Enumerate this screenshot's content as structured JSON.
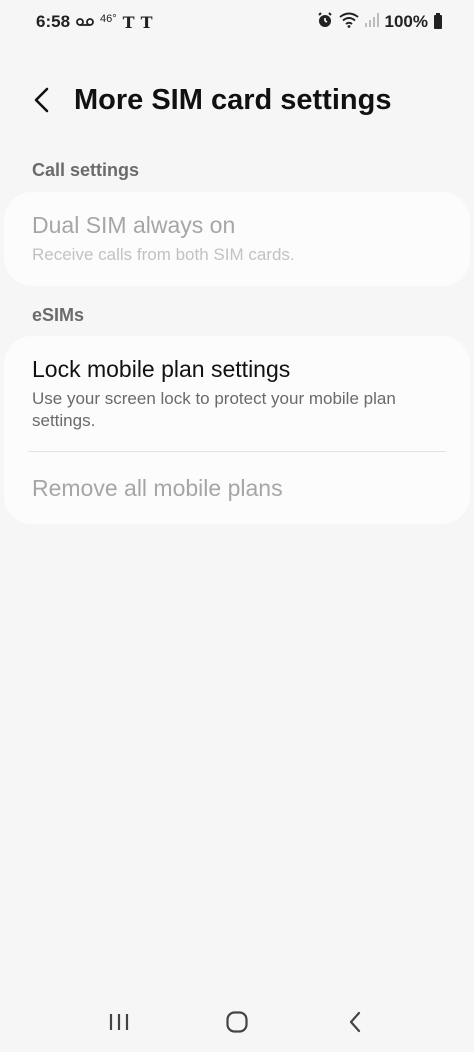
{
  "status_bar": {
    "time": "6:58",
    "temperature": "46°",
    "carrier1": "T",
    "carrier2": "T",
    "battery": "100%",
    "icons": [
      "voicemail-icon",
      "alarm-icon",
      "wifi-icon",
      "signal-icon",
      "battery-icon"
    ]
  },
  "header": {
    "title": "More SIM card settings",
    "back_icon": "chevron-left-icon"
  },
  "sections": {
    "call_settings": {
      "label": "Call settings",
      "items": [
        {
          "title": "Dual SIM always on",
          "subtitle": "Receive calls from both SIM cards.",
          "enabled": false
        }
      ]
    },
    "esims": {
      "label": "eSIMs",
      "items": [
        {
          "title": "Lock mobile plan settings",
          "subtitle": "Use your screen lock to protect your mobile plan settings.",
          "enabled": true
        },
        {
          "title": "Remove all mobile plans",
          "enabled": false
        }
      ]
    }
  },
  "nav_bar": {
    "icons": [
      "recent-apps-icon",
      "home-icon",
      "back-icon"
    ]
  },
  "colors": {
    "background": "#f6f6f6",
    "card": "#fcfcfc",
    "disabled_text": "#a6a6a6",
    "section_label": "#6b6b6b"
  }
}
